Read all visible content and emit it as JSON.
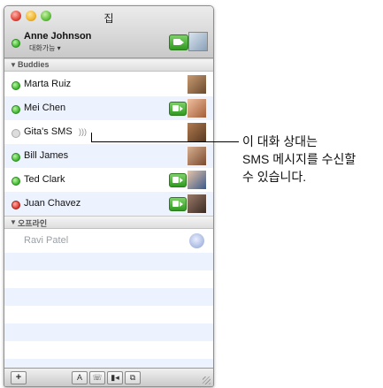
{
  "window": {
    "title": "집"
  },
  "me": {
    "name": "Anne Johnson",
    "status": "대화가능 ▾"
  },
  "groups": {
    "buddies": "Buddies",
    "offline": "오프라인"
  },
  "buddies": [
    {
      "name": "Marta Ruiz",
      "status": "available"
    },
    {
      "name": "Mei Chen",
      "status": "available",
      "video": true
    },
    {
      "name": "Gita's SMS",
      "status": "sms"
    },
    {
      "name": "Bill James",
      "status": "available"
    },
    {
      "name": "Ted Clark",
      "status": "available",
      "video": true
    },
    {
      "name": "Juan Chavez",
      "status": "busy",
      "video": true
    }
  ],
  "offline": [
    {
      "name": "Ravi Patel"
    }
  ],
  "toolbar": {
    "add": "+",
    "text": "A",
    "audio": "☏",
    "video": "▮◂",
    "screen": "⧉"
  },
  "callout": {
    "line1": "이 대화 상대는",
    "line2": "SMS 메시지를 수신할",
    "line3": "수 있습니다."
  },
  "colors": {
    "available": "#39b52a",
    "busy": "#e0332a",
    "row_alt": "#edf3fe"
  }
}
